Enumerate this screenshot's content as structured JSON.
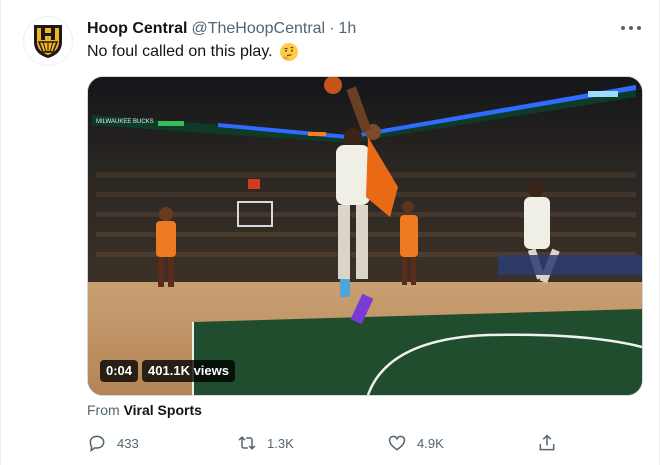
{
  "tweet": {
    "author_name": "Hoop Central",
    "author_handle": "@TheHoopCentral",
    "separator": "·",
    "time": "1h",
    "text": "No foul called on this play.",
    "emoji_name": "thinking-face-emoji"
  },
  "media": {
    "duration": "0:04",
    "views": "401.1K views",
    "scoreboard_text": "MILWAUKEE BUCKS"
  },
  "source": {
    "prefix": "From",
    "name": "Viral Sports"
  },
  "actions": {
    "reply_count": "433",
    "retweet_count": "1.3K",
    "like_count": "4.9K"
  },
  "colors": {
    "text_primary": "#0f1419",
    "text_secondary": "#536471",
    "logo_gold": "#f2b51c"
  },
  "icons": [
    "hoop-central-logo-icon",
    "more-options-icon",
    "reply-icon",
    "retweet-icon",
    "like-icon",
    "share-icon"
  ]
}
